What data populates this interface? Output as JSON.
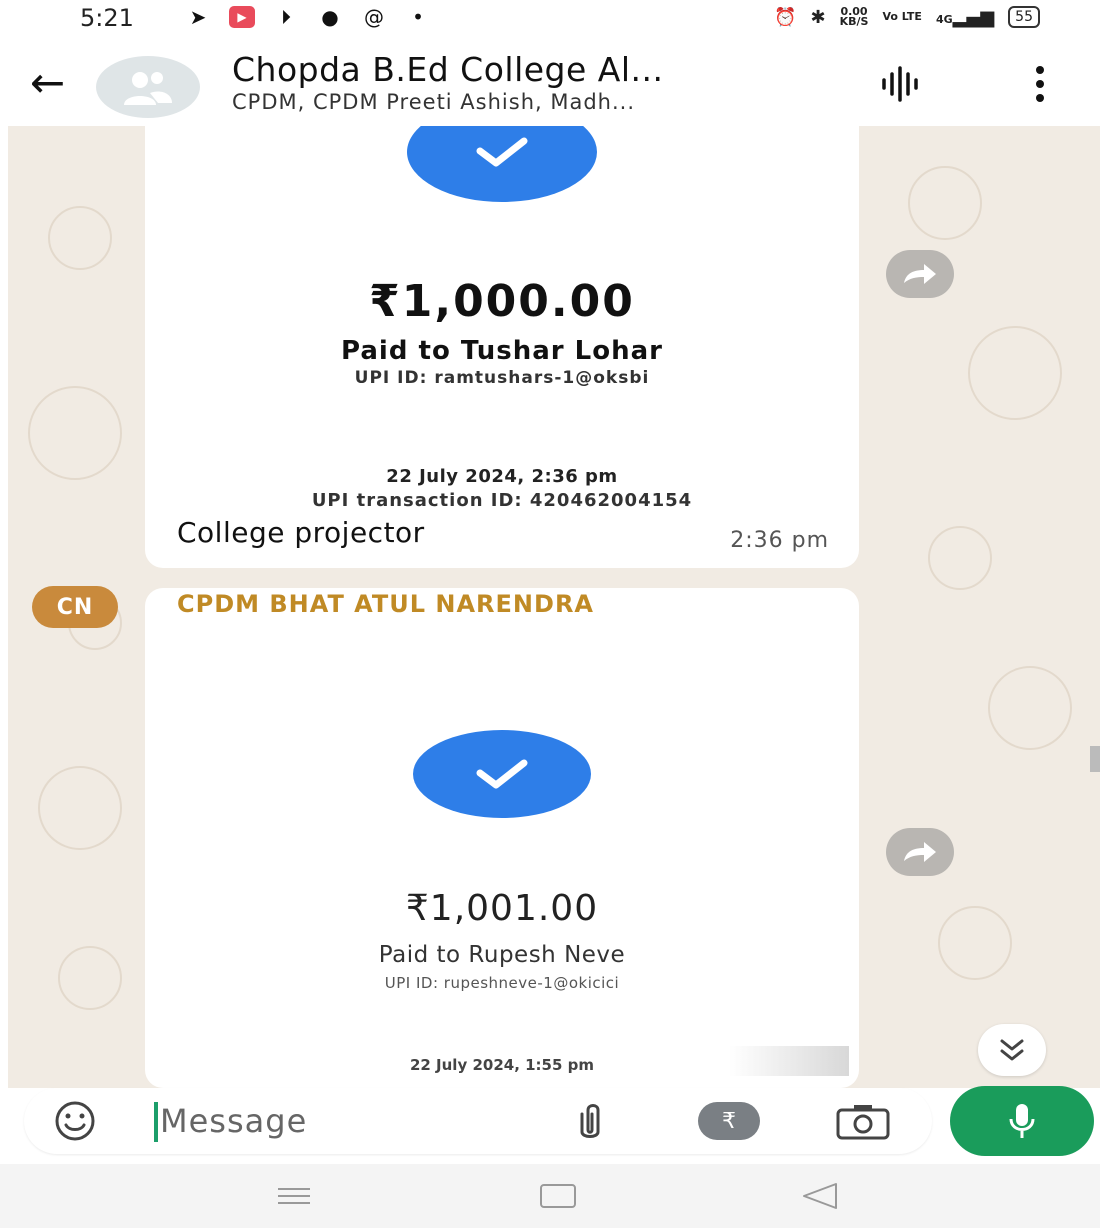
{
  "status_bar": {
    "time": "5:21",
    "net_speed_value": "0.00",
    "net_speed_unit": "KB/S",
    "volte": "Vo LTE",
    "network": "4G",
    "battery": "55",
    "left_icons": [
      "telegram-icon",
      "youtube-icon",
      "play-icon",
      "media-icon",
      "threads-icon",
      "dot-icon"
    ],
    "right_icons": [
      "alarm-icon",
      "bluetooth-icon",
      "signal-icon",
      "battery-icon"
    ]
  },
  "header": {
    "title": "Chopda B.Ed College Al...",
    "subtitle": "CPDM, CPDM Preeti Ashish, Madh..."
  },
  "messages": [
    {
      "amount": "₹1,000.00",
      "paid_to": "Paid to Tushar Lohar",
      "upi_id": "UPI ID: ramtushars-1@oksbi",
      "date": "22 July 2024, 2:36 pm",
      "transaction_id": "UPI transaction ID: 420462004154",
      "caption": "College projector",
      "time": "2:36 pm"
    },
    {
      "sender_initials": "CN",
      "sender": "CPDM BHAT ATUL NARENDRA",
      "amount": "₹1,001.00",
      "paid_to": "Paid to Rupesh Neve",
      "upi_id": "UPI ID: rupeshneve-1@okicici",
      "date": "22 July 2024, 1:55 pm"
    }
  ],
  "composer": {
    "placeholder": "Message",
    "rupee_symbol": "₹"
  },
  "colors": {
    "accent_green": "#1a9c5b",
    "check_blue": "#2e7ee8",
    "sender_gold": "#c08a25",
    "chat_background": "#f1ebe3"
  }
}
